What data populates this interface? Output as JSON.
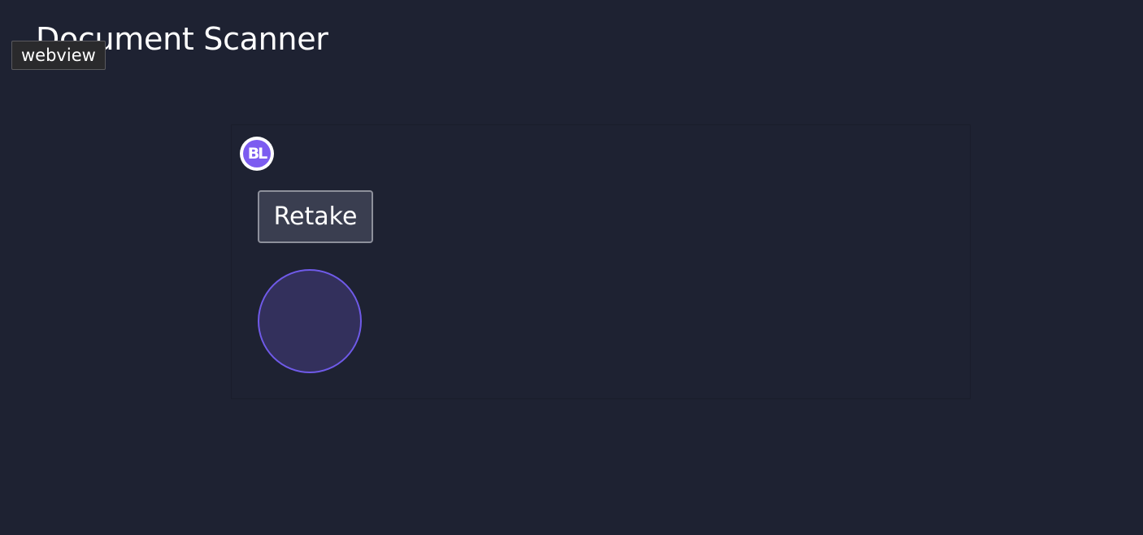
{
  "page": {
    "title": "Document Scanner"
  },
  "tooltip": {
    "text": "webview"
  },
  "scanner": {
    "logo_text": "BL",
    "retake_label": "Retake"
  },
  "colors": {
    "background": "#1e2232",
    "accent": "#7c5cf0",
    "shutter_fill": "#33305c",
    "shutter_border": "#6f5ae8",
    "button_fill": "#3a3e50"
  }
}
